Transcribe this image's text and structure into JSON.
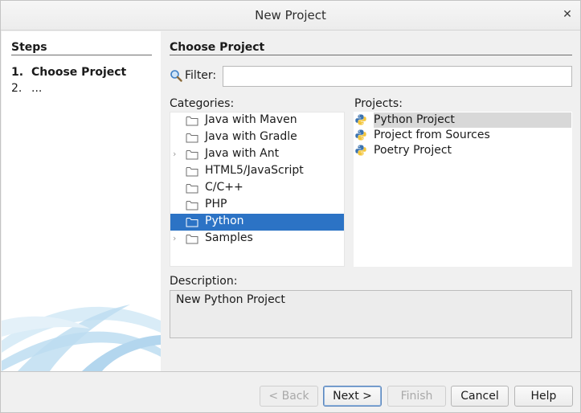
{
  "window": {
    "title": "New Project"
  },
  "steps": {
    "heading": "Steps",
    "items": [
      {
        "num": "1.",
        "label": "Choose Project"
      },
      {
        "num": "2.",
        "label": "..."
      }
    ]
  },
  "main": {
    "heading": "Choose Project",
    "filter": {
      "label": "Filter:",
      "value": "",
      "placeholder": ""
    },
    "categories_label": "Categories:",
    "categories": [
      {
        "label": "Java with Maven",
        "expandable": false
      },
      {
        "label": "Java with Gradle",
        "expandable": false
      },
      {
        "label": "Java with Ant",
        "expandable": true
      },
      {
        "label": "HTML5/JavaScript",
        "expandable": false
      },
      {
        "label": "C/C++",
        "expandable": false
      },
      {
        "label": "PHP",
        "expandable": false
      },
      {
        "label": "Python",
        "expandable": false,
        "selected": true
      },
      {
        "label": "Samples",
        "expandable": true
      }
    ],
    "projects_label": "Projects:",
    "projects": [
      {
        "label": "Python Project",
        "selected": true
      },
      {
        "label": "Project from Sources"
      },
      {
        "label": "Poetry Project"
      }
    ],
    "description_label": "Description:",
    "description": "New Python Project"
  },
  "footer": {
    "back": "< Back",
    "next": "Next >",
    "finish": "Finish",
    "cancel": "Cancel",
    "help": "Help"
  },
  "colors": {
    "selection": "#2c73c5",
    "project_selection": "#d8d8d8"
  }
}
